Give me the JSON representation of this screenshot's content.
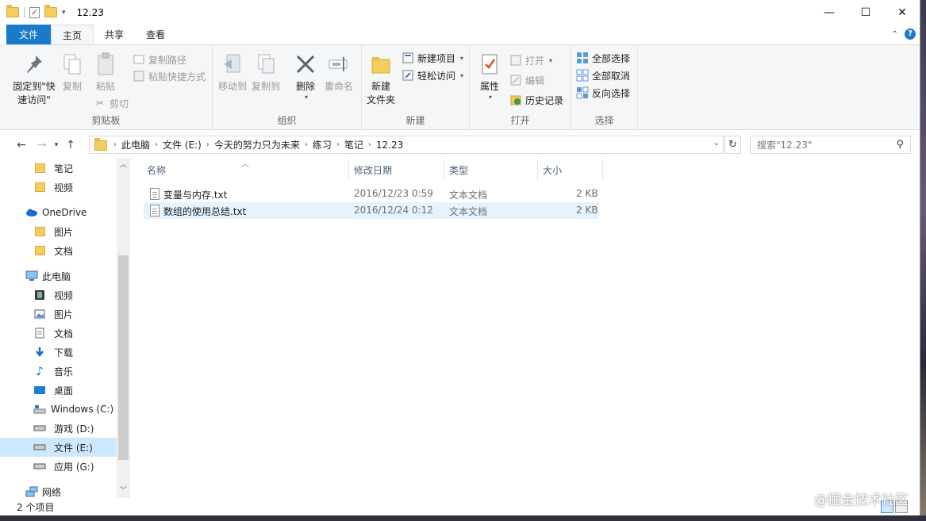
{
  "window": {
    "title": "12.23"
  },
  "ribbon_tabs": [
    "文件",
    "主页",
    "共享",
    "查看"
  ],
  "ribbon": {
    "clipboard": {
      "label": "剪贴板",
      "pin": "固定到\"快速访问\"",
      "copy": "复制",
      "paste": "粘贴",
      "copy_path": "复制路径",
      "paste_shortcut": "粘贴快捷方式",
      "cut": "剪切"
    },
    "organize": {
      "label": "组织",
      "move_to": "移动到",
      "copy_to": "复制到",
      "delete": "删除",
      "rename": "重命名"
    },
    "new": {
      "label": "新建",
      "new_folder": "新建\n文件夹",
      "new_item": "新建项目",
      "easy_access": "轻松访问"
    },
    "open": {
      "label": "打开",
      "properties": "属性",
      "open": "打开",
      "edit": "编辑",
      "history": "历史记录"
    },
    "select": {
      "label": "选择",
      "select_all": "全部选择",
      "select_none": "全部取消",
      "invert": "反向选择"
    }
  },
  "breadcrumb": [
    "此电脑",
    "文件 (E:)",
    "今天的努力只为未来",
    "练习",
    "笔记",
    "12.23"
  ],
  "search": {
    "placeholder": "搜索\"12.23\""
  },
  "nav_items": [
    {
      "label": "笔记",
      "icon": "folder-icon"
    },
    {
      "label": "视频",
      "icon": "folder-icon"
    },
    {
      "label": "OneDrive",
      "icon": "cloud-icon"
    },
    {
      "label": "图片",
      "icon": "folder-icon"
    },
    {
      "label": "文档",
      "icon": "folder-icon"
    },
    {
      "label": "此电脑",
      "icon": "computer-icon"
    },
    {
      "label": "视频",
      "icon": "video-icon"
    },
    {
      "label": "图片",
      "icon": "picture-icon"
    },
    {
      "label": "文档",
      "icon": "document-icon"
    },
    {
      "label": "下载",
      "icon": "download-icon"
    },
    {
      "label": "音乐",
      "icon": "music-icon"
    },
    {
      "label": "桌面",
      "icon": "desktop-icon"
    },
    {
      "label": "Windows (C:)",
      "icon": "drive-icon"
    },
    {
      "label": "游戏 (D:)",
      "icon": "drive-icon"
    },
    {
      "label": "文件 (E:)",
      "icon": "drive-icon"
    },
    {
      "label": "应用 (G:)",
      "icon": "drive-icon"
    },
    {
      "label": "网络",
      "icon": "network-icon"
    }
  ],
  "columns": [
    "名称",
    "修改日期",
    "类型",
    "大小"
  ],
  "files": [
    {
      "name": "变量与内存.txt",
      "date": "2016/12/23 0:59",
      "type": "文本文档",
      "size": "2 KB"
    },
    {
      "name": "数组的使用总结.txt",
      "date": "2016/12/24 0:12",
      "type": "文本文档",
      "size": "2 KB"
    }
  ],
  "status": {
    "count": "2 个项目"
  },
  "watermark": "@掘金技术社区"
}
